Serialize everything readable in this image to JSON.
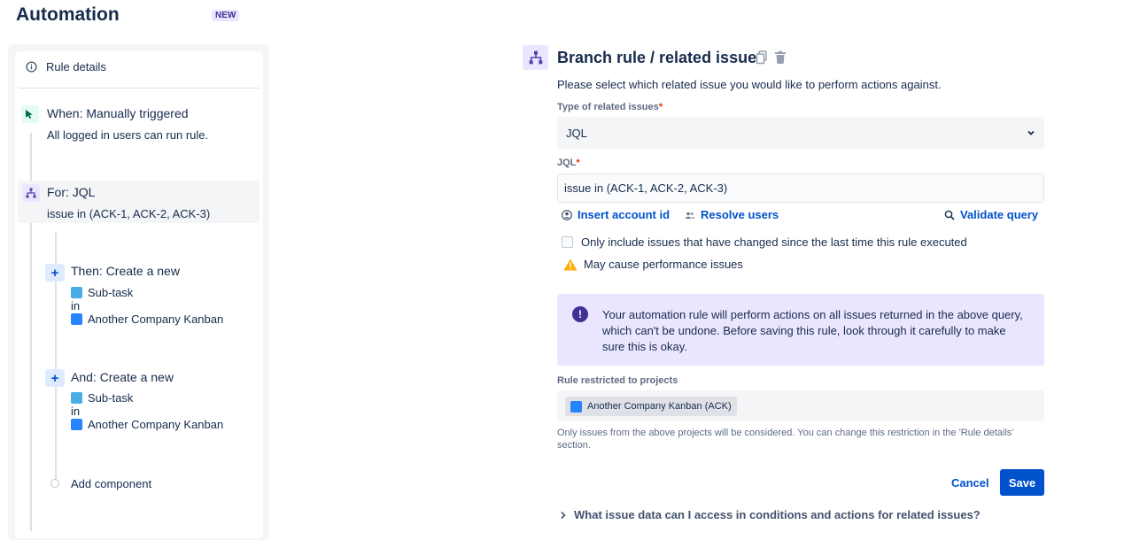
{
  "header": {
    "title": "Automation",
    "badge": "NEW"
  },
  "sidebar": {
    "rule_details": "Rule details",
    "trigger": {
      "title": "When: Manually triggered",
      "sub": "All logged in users can run rule."
    },
    "branch": {
      "title": "For: JQL",
      "sub": "issue in (ACK-1, ACK-2, ACK-3)"
    },
    "actions": [
      {
        "title": "Then: Create a new",
        "type": "Sub-task",
        "in": "in",
        "project": "Another Company Kanban"
      },
      {
        "title": "And: Create a new",
        "type": "Sub-task",
        "in": "in",
        "project": "Another Company Kanban"
      }
    ],
    "add_component": "Add component"
  },
  "panel": {
    "title": "Branch rule / related issues",
    "description": "Please select which related issue you would like to perform actions against.",
    "type_label": "Type of related issues",
    "type_value": "JQL",
    "jql_label": "JQL",
    "jql_value": "issue in (ACK-1, ACK-2, ACK-3)",
    "insert_account": "Insert account id",
    "resolve_users": "Resolve users",
    "validate_query": "Validate query",
    "only_include": "Only include issues that have changed since the last time this rule executed",
    "warning": "May cause performance issues",
    "info": "Your automation rule will perform actions on all issues returned in the above query, which can't be undone. Before saving this rule, look through it carefully to make sure this is okay.",
    "restricted_label": "Rule restricted to projects",
    "restricted_project": "Another Company Kanban (ACK)",
    "restricted_note": "Only issues from the above projects will be considered. You can change this restriction in the 'Rule details' section.",
    "cancel": "Cancel",
    "save": "Save",
    "faq": "What issue data can I access in conditions and actions for related issues?"
  }
}
